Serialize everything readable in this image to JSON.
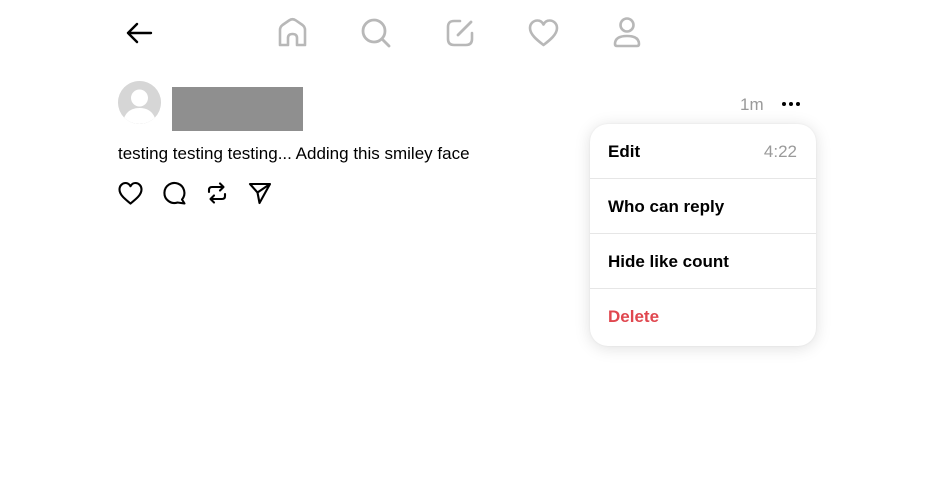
{
  "nav": {
    "back_icon": "arrow-left-icon",
    "tabs": [
      {
        "name": "home",
        "icon": "home-icon"
      },
      {
        "name": "search",
        "icon": "search-icon"
      },
      {
        "name": "compose",
        "icon": "compose-icon"
      },
      {
        "name": "activity",
        "icon": "heart-icon"
      },
      {
        "name": "profile",
        "icon": "person-icon"
      }
    ]
  },
  "post": {
    "time": "1m",
    "text": "testing testing testing... Adding this smiley face",
    "actions": [
      "like",
      "reply",
      "repost",
      "share"
    ]
  },
  "menu": {
    "items": [
      {
        "label": "Edit",
        "extra": "4:22"
      },
      {
        "label": "Who can reply"
      },
      {
        "label": "Hide like count"
      },
      {
        "label": "Delete",
        "color": "#e0474f"
      }
    ]
  },
  "colors": {
    "muted": "#9a9a9a",
    "danger": "#e0474f",
    "icon": "#000000",
    "nav_icon": "#b8b8b8"
  }
}
